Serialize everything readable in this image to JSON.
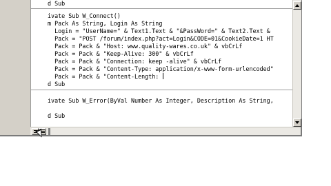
{
  "editor": {
    "lines": [
      "d Sub",
      "ivate Sub W_Connect()",
      "m Pack As String, Login As String",
      "  Login = \"UserName=\" & Text1.Text & \"&PassWord=\" & Text2.Text &",
      "  Pack = \"POST /forum/index.php?act=Login&CODE=01&CookieDate=1 HT",
      "  Pack = Pack & \"Host: www.quality-wares.co.uk\" & vbCrLf",
      "  Pack = Pack & \"Keep-Alive: 300\" & vbCrLf",
      "  Pack = Pack & \"Connection: keep -alive\" & vbCrLf",
      "  Pack = Pack & \"Content-Type: application/x-www-form-urlencoded\"",
      "  Pack = Pack & \"Content-Length: ",
      "d Sub",
      "ivate Sub W_Error(ByVal Number As Integer, Description As String,",
      "d Sub"
    ]
  },
  "icons": {
    "scroll_up": "arrow-up-icon",
    "scroll_down": "arrow-down-icon",
    "procedure_view": "procedure-view-icon",
    "full_module_view": "full-module-view-icon",
    "cursor": "mouse-pointer-icon"
  }
}
